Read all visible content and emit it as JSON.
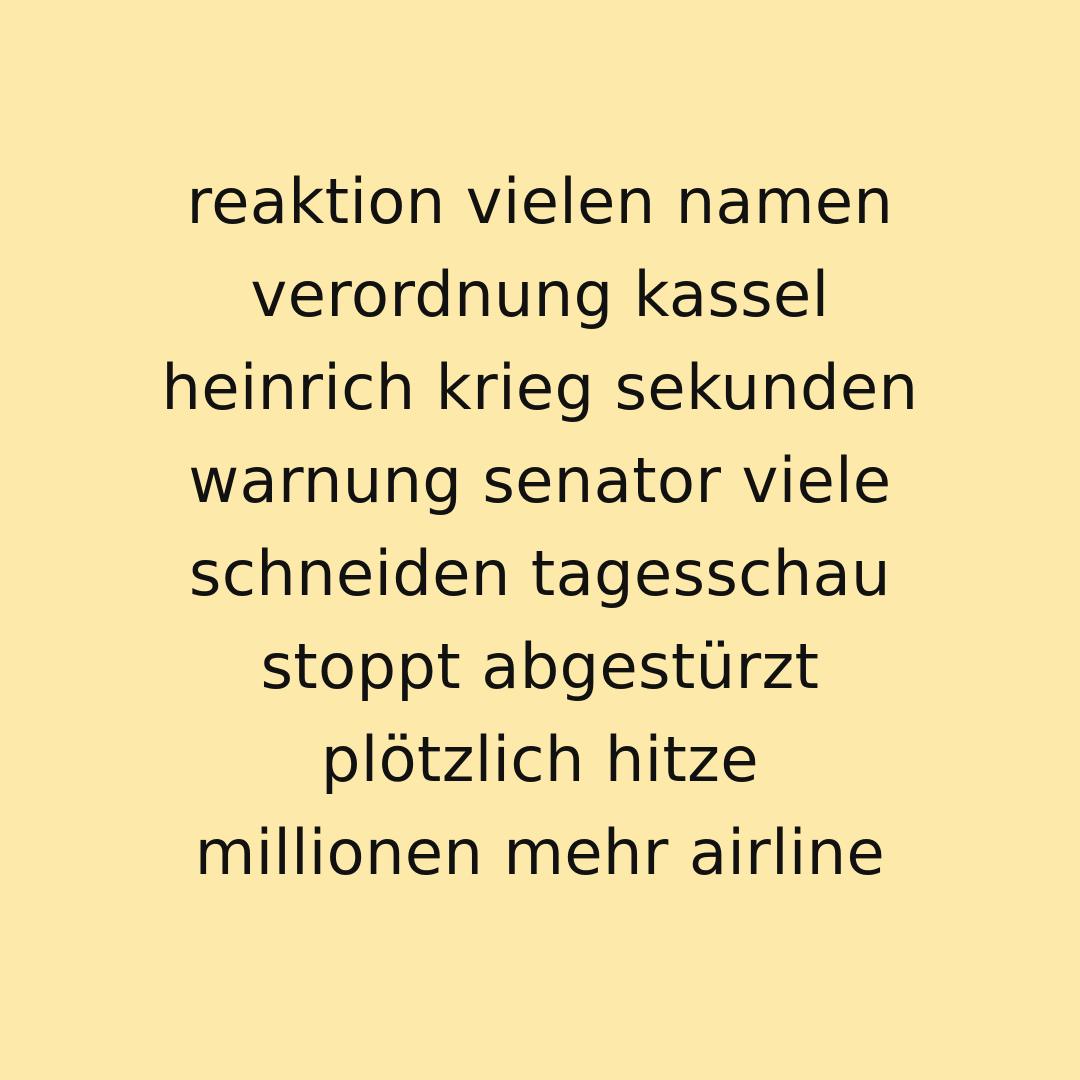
{
  "colors": {
    "background": "#FDE9AA",
    "text": "#111111"
  },
  "lines": [
    "reaktion vielen namen",
    "verordnung kassel",
    "heinrich krieg sekunden",
    "warnung senator viele",
    "schneiden tagesschau",
    "stoppt abgestürzt",
    "plötzlich hitze",
    "millionen mehr airline"
  ]
}
